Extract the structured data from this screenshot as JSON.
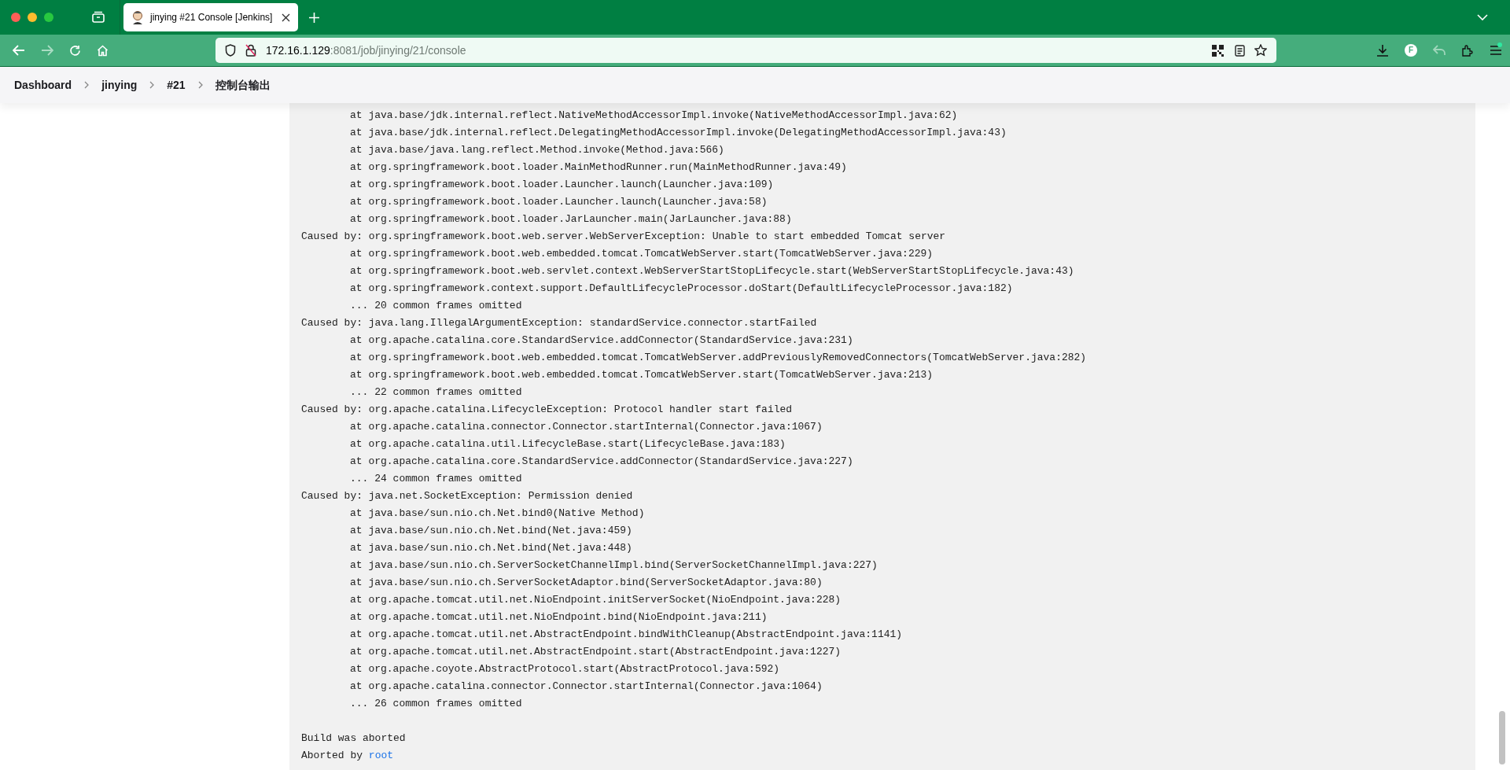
{
  "tab": {
    "title": "jinying #21 Console [Jenkins]",
    "selected": true
  },
  "address": {
    "host": "172.16.1.129",
    "rest": ":8081/job/jinying/21/console"
  },
  "profile": {
    "initial": "F"
  },
  "breadcrumbs": [
    "Dashboard",
    "jinying",
    "#21",
    "控制台输出"
  ],
  "console": [
    {
      "kind": "frame",
      "text": "at java.base/jdk.internal.reflect.NativeMethodAccessorImpl.invoke(NativeMethodAccessorImpl.java:62)"
    },
    {
      "kind": "frame",
      "text": "at java.base/jdk.internal.reflect.DelegatingMethodAccessorImpl.invoke(DelegatingMethodAccessorImpl.java:43)"
    },
    {
      "kind": "frame",
      "text": "at java.base/java.lang.reflect.Method.invoke(Method.java:566)"
    },
    {
      "kind": "frame",
      "text": "at org.springframework.boot.loader.MainMethodRunner.run(MainMethodRunner.java:49)"
    },
    {
      "kind": "frame",
      "text": "at org.springframework.boot.loader.Launcher.launch(Launcher.java:109)"
    },
    {
      "kind": "frame",
      "text": "at org.springframework.boot.loader.Launcher.launch(Launcher.java:58)"
    },
    {
      "kind": "frame",
      "text": "at org.springframework.boot.loader.JarLauncher.main(JarLauncher.java:88)"
    },
    {
      "kind": "cause",
      "text": "Caused by: org.springframework.boot.web.server.WebServerException: Unable to start embedded Tomcat server"
    },
    {
      "kind": "frame",
      "text": "at org.springframework.boot.web.embedded.tomcat.TomcatWebServer.start(TomcatWebServer.java:229)"
    },
    {
      "kind": "frame",
      "text": "at org.springframework.boot.web.servlet.context.WebServerStartStopLifecycle.start(WebServerStartStopLifecycle.java:43)"
    },
    {
      "kind": "frame",
      "text": "at org.springframework.context.support.DefaultLifecycleProcessor.doStart(DefaultLifecycleProcessor.java:182)"
    },
    {
      "kind": "frame",
      "text": "... 20 common frames omitted"
    },
    {
      "kind": "cause",
      "text": "Caused by: java.lang.IllegalArgumentException: standardService.connector.startFailed"
    },
    {
      "kind": "frame",
      "text": "at org.apache.catalina.core.StandardService.addConnector(StandardService.java:231)"
    },
    {
      "kind": "frame",
      "text": "at org.springframework.boot.web.embedded.tomcat.TomcatWebServer.addPreviouslyRemovedConnectors(TomcatWebServer.java:282)"
    },
    {
      "kind": "frame",
      "text": "at org.springframework.boot.web.embedded.tomcat.TomcatWebServer.start(TomcatWebServer.java:213)"
    },
    {
      "kind": "frame",
      "text": "... 22 common frames omitted"
    },
    {
      "kind": "cause",
      "text": "Caused by: org.apache.catalina.LifecycleException: Protocol handler start failed"
    },
    {
      "kind": "frame",
      "text": "at org.apache.catalina.connector.Connector.startInternal(Connector.java:1067)"
    },
    {
      "kind": "frame",
      "text": "at org.apache.catalina.util.LifecycleBase.start(LifecycleBase.java:183)"
    },
    {
      "kind": "frame",
      "text": "at org.apache.catalina.core.StandardService.addConnector(StandardService.java:227)"
    },
    {
      "kind": "frame",
      "text": "... 24 common frames omitted"
    },
    {
      "kind": "cause",
      "text": "Caused by: java.net.SocketException: Permission denied"
    },
    {
      "kind": "frame",
      "text": "at java.base/sun.nio.ch.Net.bind0(Native Method)"
    },
    {
      "kind": "frame",
      "text": "at java.base/sun.nio.ch.Net.bind(Net.java:459)"
    },
    {
      "kind": "frame",
      "text": "at java.base/sun.nio.ch.Net.bind(Net.java:448)"
    },
    {
      "kind": "frame",
      "text": "at java.base/sun.nio.ch.ServerSocketChannelImpl.bind(ServerSocketChannelImpl.java:227)"
    },
    {
      "kind": "frame",
      "text": "at java.base/sun.nio.ch.ServerSocketAdaptor.bind(ServerSocketAdaptor.java:80)"
    },
    {
      "kind": "frame",
      "text": "at org.apache.tomcat.util.net.NioEndpoint.initServerSocket(NioEndpoint.java:228)"
    },
    {
      "kind": "frame",
      "text": "at org.apache.tomcat.util.net.NioEndpoint.bind(NioEndpoint.java:211)"
    },
    {
      "kind": "frame",
      "text": "at org.apache.tomcat.util.net.AbstractEndpoint.bindWithCleanup(AbstractEndpoint.java:1141)"
    },
    {
      "kind": "frame",
      "text": "at org.apache.tomcat.util.net.AbstractEndpoint.start(AbstractEndpoint.java:1227)"
    },
    {
      "kind": "frame",
      "text": "at org.apache.coyote.AbstractProtocol.start(AbstractProtocol.java:592)"
    },
    {
      "kind": "frame",
      "text": "at org.apache.catalina.connector.Connector.startInternal(Connector.java:1064)"
    },
    {
      "kind": "frame",
      "text": "... 26 common frames omitted"
    },
    {
      "kind": "blank"
    },
    {
      "kind": "text",
      "text": "Build was aborted"
    },
    {
      "kind": "link_line",
      "text": "Aborted by",
      "link": "root"
    }
  ]
}
